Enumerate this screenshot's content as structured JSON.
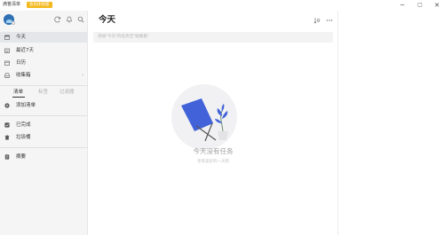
{
  "window": {
    "title": "滴答清单",
    "badge": "会员体验版",
    "minimize": "─",
    "maximize": "▢",
    "close": "✕"
  },
  "sidebar": {
    "nav": [
      {
        "label": "今天",
        "icon": "calendar-today-icon"
      },
      {
        "label": "最近7天",
        "icon": "calendar-week-icon"
      },
      {
        "label": "日历",
        "icon": "calendar-icon"
      },
      {
        "label": "收集箱",
        "icon": "inbox-icon"
      }
    ],
    "tabs": [
      "清单",
      "标签",
      "过滤器"
    ],
    "add_list": "添加清单",
    "bottom": [
      {
        "label": "已完成",
        "icon": "checkbox-icon"
      },
      {
        "label": "垃圾桶",
        "icon": "trash-icon"
      }
    ],
    "summary": {
      "label": "摘要",
      "icon": "document-icon"
    },
    "nav_more": "›"
  },
  "main": {
    "title": "今天",
    "add_placeholder": "添加\"今天\"的任务至\"收集箱\"",
    "empty_title": "今天没有任务",
    "empty_subtitle": "享受美好的一天吧"
  },
  "colors": {
    "accent": "#4162d9",
    "sidebar_bg": "#f5f5f5",
    "active_item": "#e4e6ea"
  }
}
